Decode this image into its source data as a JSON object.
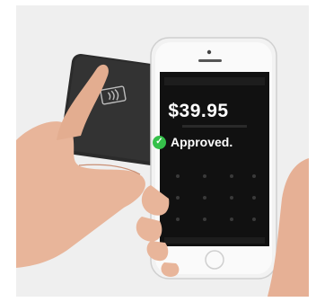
{
  "screen": {
    "amount": "$39.95",
    "status": "Approved."
  },
  "colors": {
    "background": "#efefef",
    "reader": "#2b2b2b",
    "phone_body": "#f2f2f2",
    "screen": "#111111",
    "approved_icon": "#35c04a"
  }
}
